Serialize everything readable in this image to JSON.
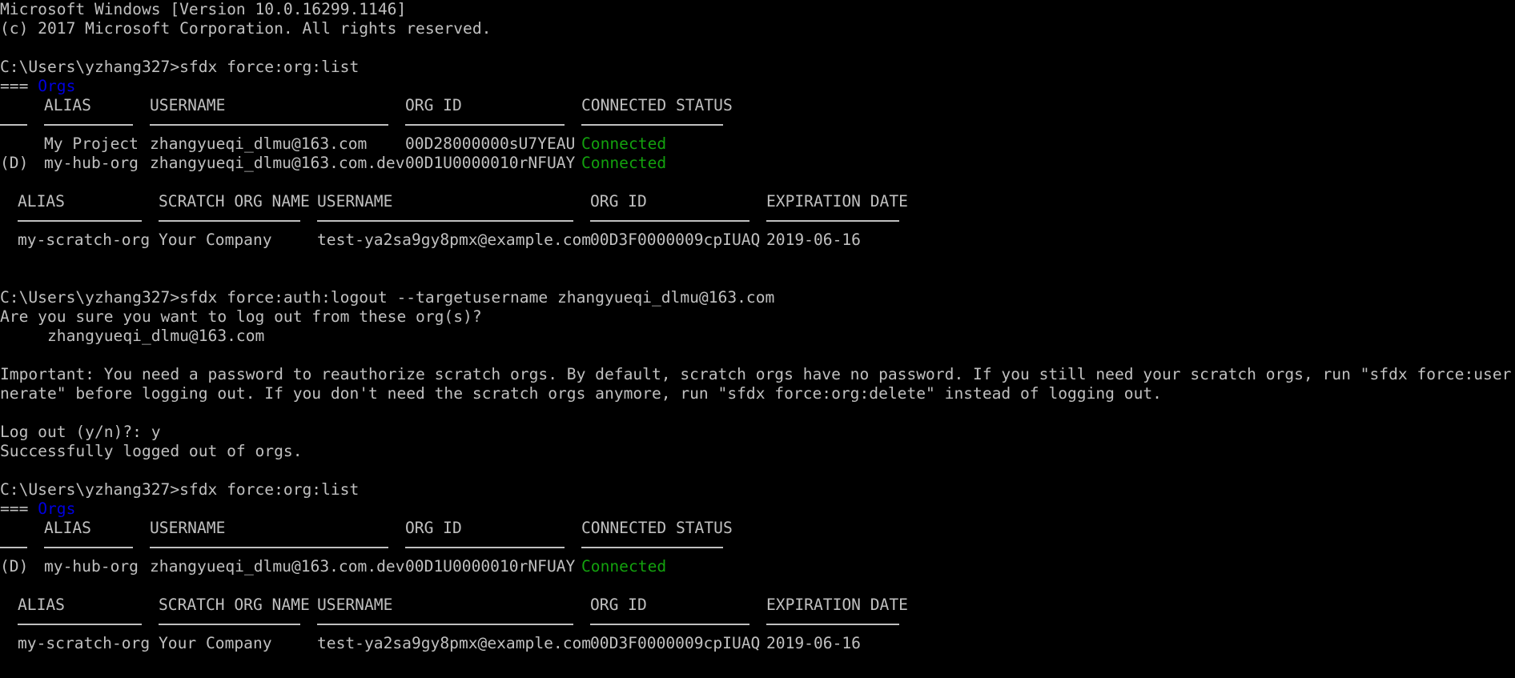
{
  "banner": {
    "version": "Microsoft Windows [Version 10.0.16299.1146]",
    "copyright": "(c) 2017 Microsoft Corporation. All rights reserved."
  },
  "colors": {
    "background": "#000000",
    "text": "#c0c0c0",
    "orgs_heading": "#0000e0",
    "connected": "#13a10e"
  },
  "session1": {
    "prompt": "C:\\Users\\yzhang327>sfdx force:org:list",
    "heading_prefix": "===",
    "heading": "Orgs",
    "nonscratch_headers": [
      "ALIAS",
      "USERNAME",
      "ORG ID",
      "CONNECTED STATUS"
    ],
    "nonscratch_rows": [
      {
        "marker": "",
        "alias": "My Project",
        "username": "zhangyueqi_dlmu@163.com",
        "org_id": "00D28000000sU7YEAU",
        "status": "Connected"
      },
      {
        "marker": "(D)",
        "alias": "my-hub-org",
        "username": "zhangyueqi_dlmu@163.com.dev",
        "org_id": "00D1U0000010rNFUAY",
        "status": "Connected"
      }
    ],
    "scratch_headers": [
      "ALIAS",
      "SCRATCH ORG NAME",
      "USERNAME",
      "ORG ID",
      "EXPIRATION DATE"
    ],
    "scratch_rows": [
      {
        "alias": "my-scratch-org",
        "name": "Your Company",
        "username": "test-ya2sa9gy8pmx@example.com",
        "org_id": "00D3F0000009cpIUAQ",
        "expiration": "2019-06-16"
      }
    ]
  },
  "logout": {
    "prompt": "C:\\Users\\yzhang327>sfdx force:auth:logout --targetusername zhangyueqi_dlmu@163.com",
    "question": "Are you sure you want to log out from these org(s)?",
    "target": "     zhangyueqi_dlmu@163.com",
    "important_line1": "Important: You need a password to reauthorize scratch orgs. By default, scratch orgs have no password. If you still need your scratch orgs, run \"sfdx force:user:password:ge",
    "important_line2": "nerate\" before logging out. If you don't need the scratch orgs anymore, run \"sfdx force:org:delete\" instead of logging out.",
    "confirm": "Log out (y/n)?: y",
    "result": "Successfully logged out of orgs."
  },
  "session2": {
    "prompt": "C:\\Users\\yzhang327>sfdx force:org:list",
    "heading_prefix": "===",
    "heading": "Orgs",
    "nonscratch_headers": [
      "ALIAS",
      "USERNAME",
      "ORG ID",
      "CONNECTED STATUS"
    ],
    "nonscratch_rows": [
      {
        "marker": "(D)",
        "alias": "my-hub-org",
        "username": "zhangyueqi_dlmu@163.com.dev",
        "org_id": "00D1U0000010rNFUAY",
        "status": "Connected"
      }
    ],
    "scratch_headers": [
      "ALIAS",
      "SCRATCH ORG NAME",
      "USERNAME",
      "ORG ID",
      "EXPIRATION DATE"
    ],
    "scratch_rows": [
      {
        "alias": "my-scratch-org",
        "name": "Your Company",
        "username": "test-ya2sa9gy8pmx@example.com",
        "org_id": "00D3F0000009cpIUAQ",
        "expiration": "2019-06-16"
      }
    ]
  }
}
